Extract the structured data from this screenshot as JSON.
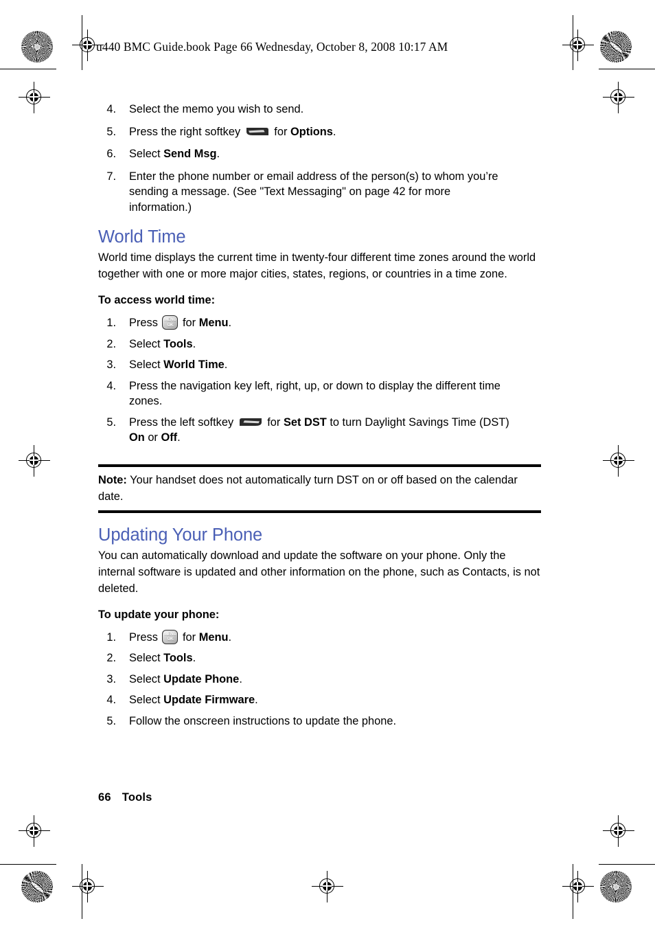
{
  "header": {
    "text": "u440 BMC Guide.book  Page 66  Wednesday, October 8, 2008  10:17 AM"
  },
  "colors": {
    "heading_blue": "#4a5fb5",
    "body_black": "#000000"
  },
  "memo_steps": {
    "items": [
      {
        "num": "4.",
        "parts": [
          {
            "type": "text",
            "text": "Select the memo you wish to send."
          }
        ]
      },
      {
        "num": "5.",
        "parts": [
          {
            "type": "text",
            "text": "Press the right softkey "
          },
          {
            "type": "icon",
            "icon": "right-softkey-icon"
          },
          {
            "type": "text",
            "text": " for "
          },
          {
            "type": "bold",
            "text": "Options"
          },
          {
            "type": "text",
            "text": "."
          }
        ]
      },
      {
        "num": "6.",
        "parts": [
          {
            "type": "text",
            "text": "Select "
          },
          {
            "type": "bold",
            "text": "Send Msg"
          },
          {
            "type": "text",
            "text": "."
          }
        ]
      },
      {
        "num": "7.",
        "parts": [
          {
            "type": "text",
            "text": "Enter the phone number or email address of the person(s) to whom you’re sending a message. (See \"Text Messaging\" on page 42 for more information.)"
          }
        ]
      }
    ]
  },
  "world_time": {
    "heading": "World Time",
    "body": "World time displays the current time in twenty-four different time zones around the world together with one or more major cities, states, regions, or countries in a time zone.",
    "lead_in": "To access world time:",
    "steps": [
      {
        "num": "1.",
        "parts": [
          {
            "type": "text",
            "text": "Press "
          },
          {
            "type": "icon",
            "icon": "menu-ok-key-icon"
          },
          {
            "type": "text",
            "text": " for "
          },
          {
            "type": "bold",
            "text": "Menu"
          },
          {
            "type": "text",
            "text": "."
          }
        ]
      },
      {
        "num": "2.",
        "parts": [
          {
            "type": "text",
            "text": "Select "
          },
          {
            "type": "bold",
            "text": "Tools"
          },
          {
            "type": "text",
            "text": "."
          }
        ]
      },
      {
        "num": "3.",
        "parts": [
          {
            "type": "text",
            "text": "Select "
          },
          {
            "type": "bold",
            "text": "World Time"
          },
          {
            "type": "text",
            "text": "."
          }
        ]
      },
      {
        "num": "4.",
        "parts": [
          {
            "type": "text",
            "text": "Press the navigation key left, right, up, or down to display the different time zones."
          }
        ]
      },
      {
        "num": "5.",
        "parts": [
          {
            "type": "text",
            "text": "Press the left softkey "
          },
          {
            "type": "icon",
            "icon": "left-softkey-icon"
          },
          {
            "type": "text",
            "text": " for "
          },
          {
            "type": "bold",
            "text": "Set DST"
          },
          {
            "type": "text",
            "text": " to turn Daylight Savings Time (DST) "
          },
          {
            "type": "bold",
            "text": "On"
          },
          {
            "type": "text",
            "text": " or "
          },
          {
            "type": "bold",
            "text": "Off"
          },
          {
            "type": "text",
            "text": "."
          }
        ]
      }
    ]
  },
  "note": {
    "label": "Note:",
    "text": " Your handset does not automatically turn DST on or off based on the calendar date."
  },
  "updating_phone": {
    "heading": "Updating Your Phone",
    "body": "You can automatically download and update the software on your phone. Only the internal software is updated and other information on the phone, such as Contacts, is not deleted.",
    "lead_in": "To update your phone:",
    "steps": [
      {
        "num": "1.",
        "parts": [
          {
            "type": "text",
            "text": "Press "
          },
          {
            "type": "icon",
            "icon": "menu-ok-key-icon"
          },
          {
            "type": "text",
            "text": " for "
          },
          {
            "type": "bold",
            "text": "Menu"
          },
          {
            "type": "text",
            "text": "."
          }
        ]
      },
      {
        "num": "2.",
        "parts": [
          {
            "type": "text",
            "text": "Select "
          },
          {
            "type": "bold",
            "text": "Tools"
          },
          {
            "type": "text",
            "text": "."
          }
        ]
      },
      {
        "num": "3.",
        "parts": [
          {
            "type": "text",
            "text": "Select "
          },
          {
            "type": "bold",
            "text": "Update Phone"
          },
          {
            "type": "text",
            "text": "."
          }
        ]
      },
      {
        "num": "4.",
        "parts": [
          {
            "type": "text",
            "text": "Select "
          },
          {
            "type": "bold",
            "text": "Update Firmware"
          },
          {
            "type": "text",
            "text": "."
          }
        ]
      },
      {
        "num": "5.",
        "parts": [
          {
            "type": "text",
            "text": "Follow the onscreen instructions to update the phone."
          }
        ]
      }
    ]
  },
  "footer": {
    "page_number": "66",
    "chapter": "Tools"
  },
  "key_icons": {
    "menu_ok": {
      "line1": "MENU",
      "line2": "OK"
    }
  }
}
